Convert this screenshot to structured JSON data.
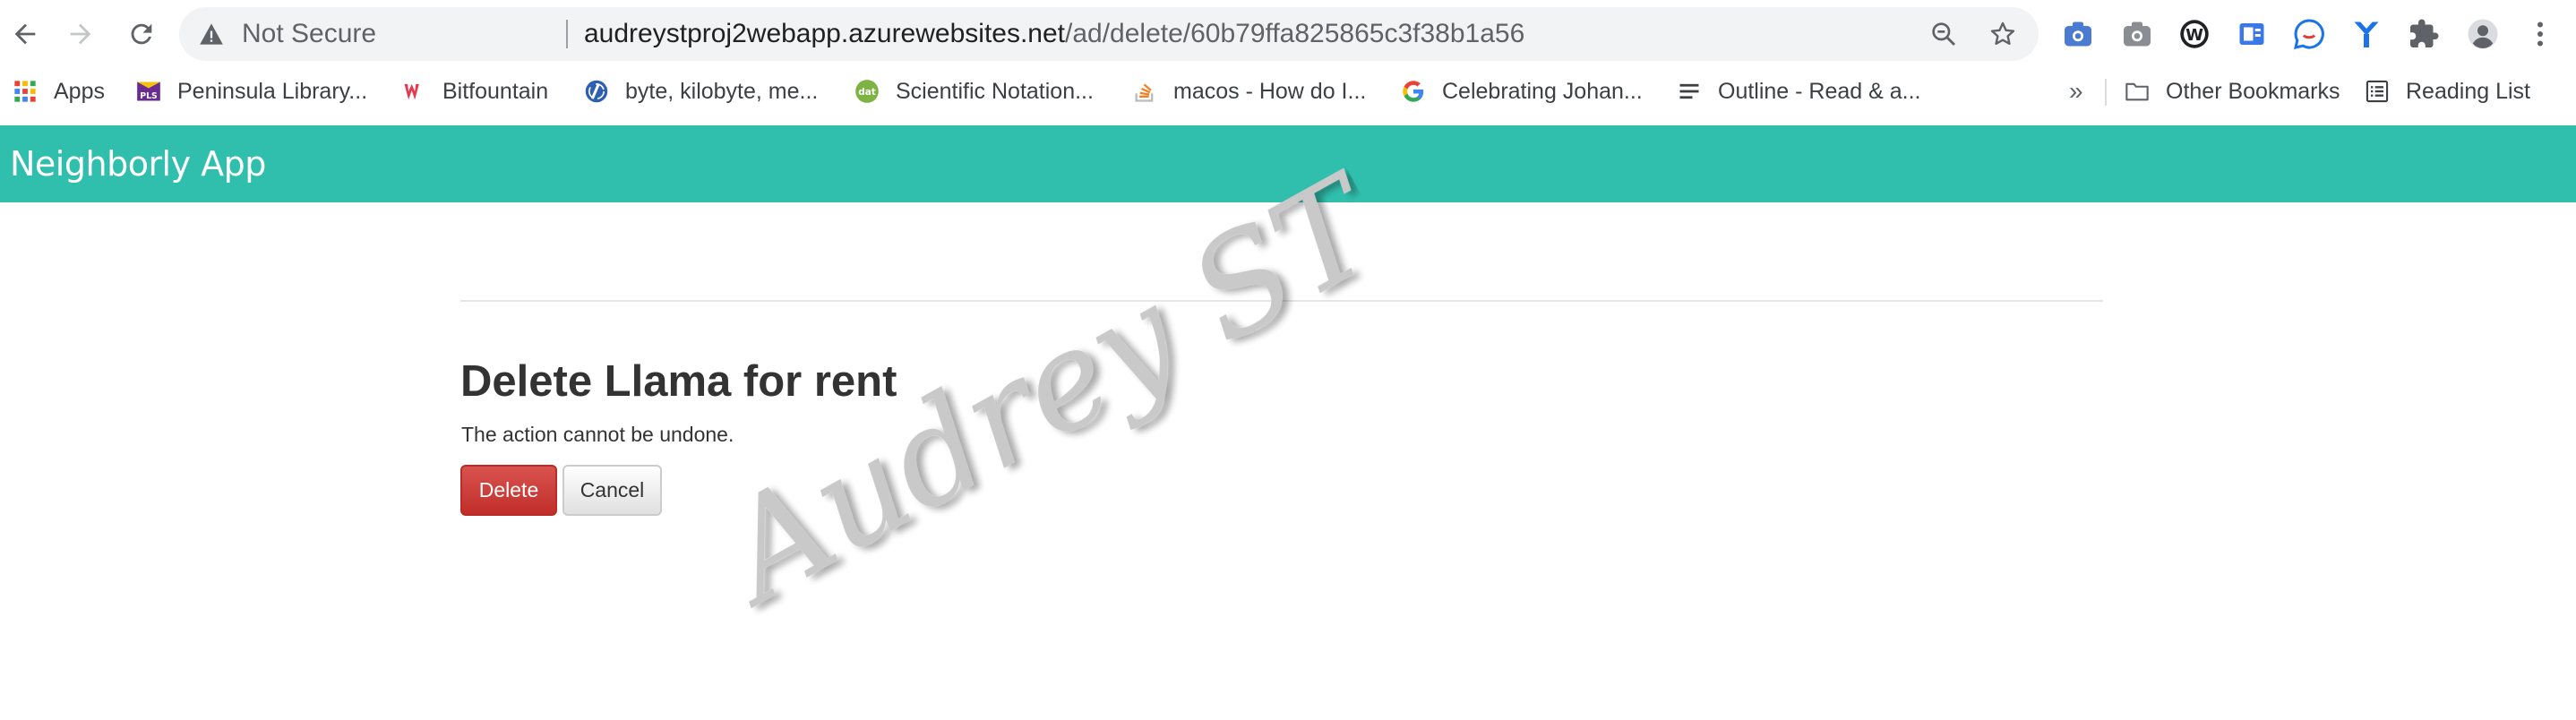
{
  "browser": {
    "security_label": "Not Secure",
    "url_host": "audreystproj2webapp.azurewebsites.net",
    "url_path": "/ad/delete/60b79ffa825865c3f38b1a56"
  },
  "bookmarks": {
    "items": [
      {
        "label": "Apps",
        "icon": "apps-grid-icon"
      },
      {
        "label": "Peninsula Library...",
        "icon": "pls-icon"
      },
      {
        "label": "Bitfountain",
        "icon": "bitfountain-icon"
      },
      {
        "label": "byte, kilobyte, me...",
        "icon": "byte-site-icon"
      },
      {
        "label": "Scientific Notation...",
        "icon": "dat-icon"
      },
      {
        "label": "macos - How do I...",
        "icon": "stackoverflow-icon"
      },
      {
        "label": "Celebrating Johan...",
        "icon": "google-icon"
      },
      {
        "label": "Outline - Read & a...",
        "icon": "outline-icon"
      }
    ],
    "overflow": "»",
    "other_label": "Other Bookmarks",
    "reading_list_label": "Reading List"
  },
  "app": {
    "brand": "Neighborly App"
  },
  "page": {
    "title": "Delete Llama for rent",
    "subtitle": "The action cannot be undone.",
    "delete_label": "Delete",
    "cancel_label": "Cancel"
  },
  "watermark": {
    "text": "Audrey ST"
  },
  "colors": {
    "navbar": "#31bfad",
    "delete_button": "#c9302c",
    "omnibox": "#f1f3f4"
  }
}
